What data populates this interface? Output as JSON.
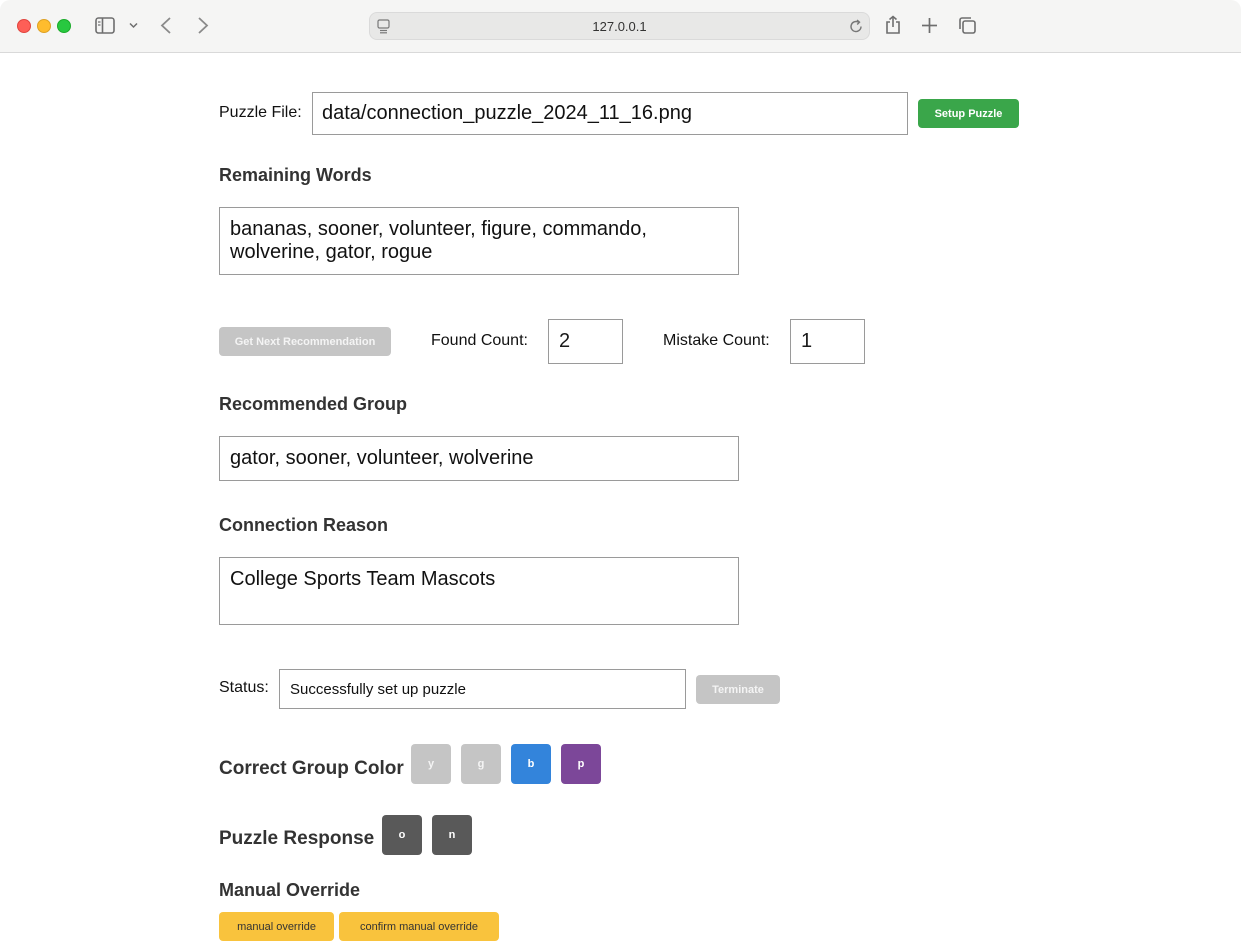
{
  "browser": {
    "url": "127.0.0.1"
  },
  "form": {
    "puzzle_file_label": "Puzzle File:",
    "puzzle_file_value": "data/connection_puzzle_2024_11_16.png",
    "setup_button": "Setup Puzzle",
    "remaining_heading": "Remaining Words",
    "remaining_value": "bananas, sooner, volunteer, figure, commando, wolverine, gator, rogue",
    "next_button": "Get Next Recommendation",
    "found_label": "Found Count:",
    "found_value": "2",
    "mistake_label": "Mistake Count:",
    "mistake_value": "1",
    "recommended_heading": "Recommended Group",
    "recommended_value": "gator, sooner, volunteer, wolverine",
    "reason_heading": "Connection Reason",
    "reason_value": "College Sports Team Mascots",
    "status_label": "Status:",
    "status_value": "Successfully set up puzzle",
    "terminate_button": "Terminate",
    "color_heading": "Correct Group Color",
    "color_buttons": [
      "y",
      "g",
      "b",
      "p"
    ],
    "response_heading": "Puzzle Response",
    "response_buttons": [
      "o",
      "n"
    ],
    "override_heading": "Manual Override",
    "override_button": "manual override",
    "confirm_override_button": "confirm manual override"
  },
  "colors": {
    "green": "#3aa64a",
    "gray": "#c5c5c5",
    "blue": "#3384db",
    "purple": "#7c4799",
    "dark": "#595959",
    "gold": "#f9c33d"
  },
  "icons": [
    "sidebar-icon",
    "chevron-down-icon",
    "back-icon",
    "forward-icon",
    "site-icon",
    "reload-icon",
    "share-icon",
    "new-tab-icon",
    "tabs-overview-icon"
  ]
}
